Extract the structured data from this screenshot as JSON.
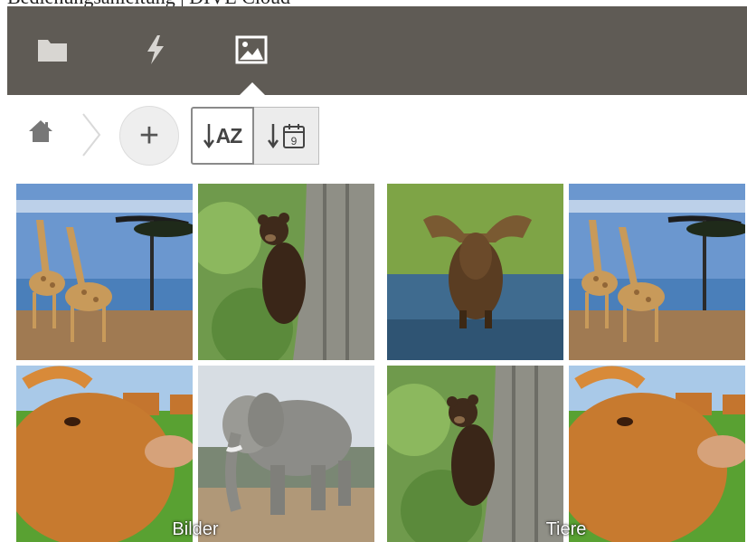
{
  "document": {
    "title": "Bedienungsanleitung | DIVE Cloud"
  },
  "topbar": {
    "background": "#5f5b55",
    "tabs": [
      {
        "name": "files",
        "icon": "folder-icon",
        "active": false
      },
      {
        "name": "activity",
        "icon": "lightning-icon",
        "active": false
      },
      {
        "name": "gallery",
        "icon": "image-icon",
        "active": true
      }
    ]
  },
  "toolbar": {
    "home_icon": "home-icon",
    "add_label": "+",
    "sort_name_label": "AZ",
    "sort_date_day": "9"
  },
  "folders": [
    {
      "name": "Bilder",
      "thumbnails": [
        "giraffes",
        "bear-cub",
        "cow",
        "elephant"
      ]
    },
    {
      "name": "Tiere",
      "thumbnails": [
        "moose",
        "giraffes",
        "bear-cub",
        "cow"
      ]
    }
  ]
}
